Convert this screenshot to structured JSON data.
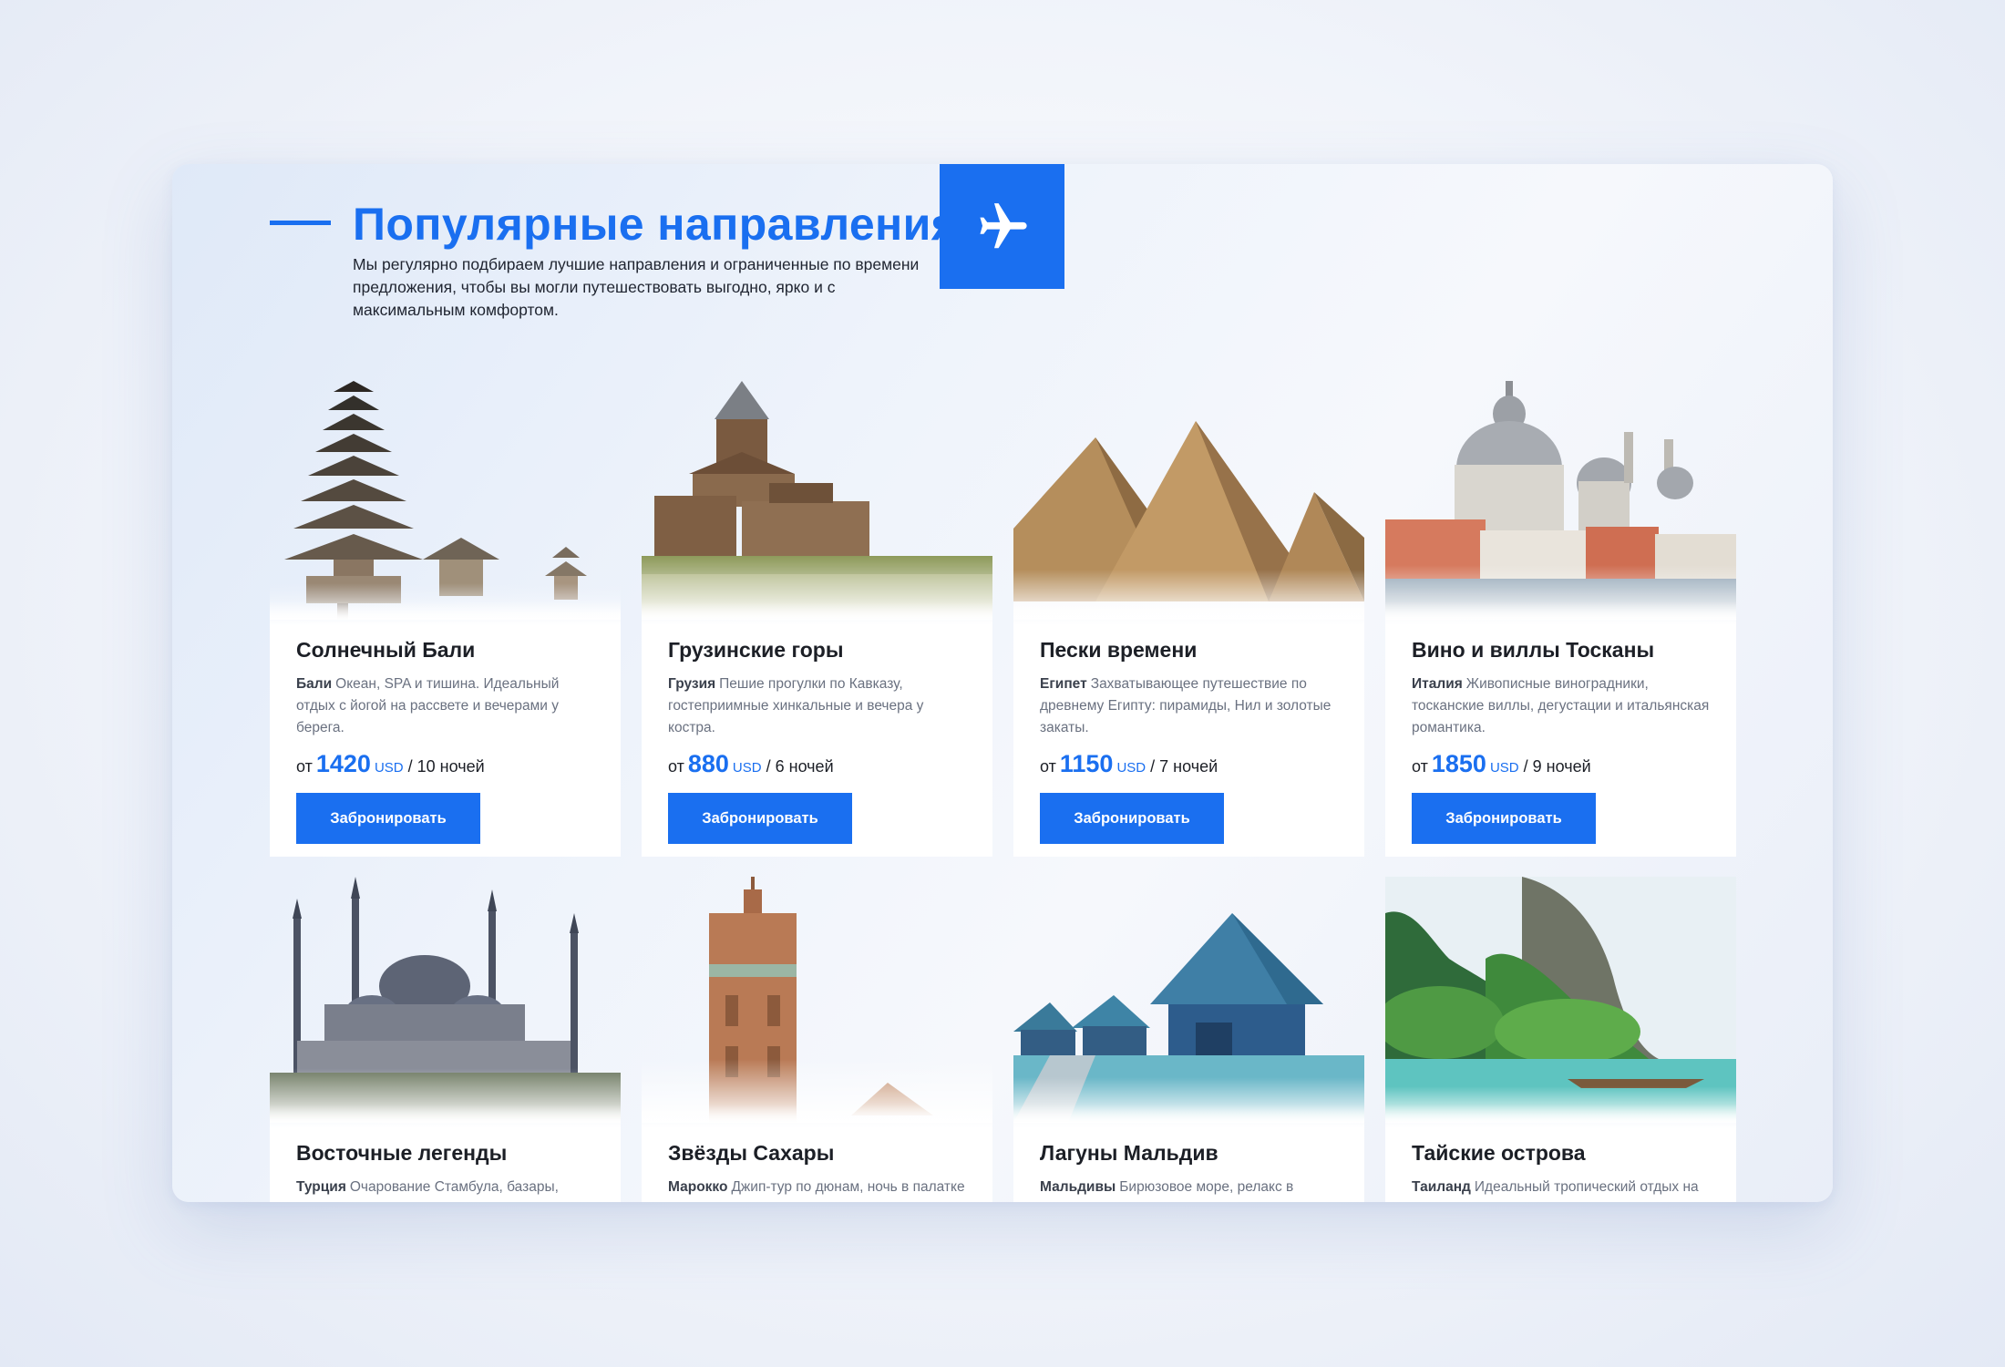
{
  "section": {
    "title": "Популярные направления",
    "description": "Мы регулярно подбираем лучшие направления и ограниченные по времени предложения, чтобы вы могли путешествовать выгодно, ярко и с максимальным комфортом.",
    "icon": "airplane-icon"
  },
  "colors": {
    "accent": "#1a6ff0",
    "text": "#1c1f26",
    "muted": "#6a7180"
  },
  "cards": [
    {
      "title": "Солнечный Бали",
      "country": "Бали",
      "text": "Океан, SPA и тишина. Идеальный отдых с йогой на рассвете и вечерами у берега.",
      "from": "от",
      "price": "1420",
      "currency": "USD",
      "nights": "/ 10 ночей",
      "button": "Забронировать",
      "image": "bali-temple-image"
    },
    {
      "title": "Грузинские горы",
      "country": "Грузия",
      "text": "Пешие прогулки по Кавказу, гостеприимные хинкальные и вечера у костра.",
      "from": "от",
      "price": "880",
      "currency": "USD",
      "nights": "/ 6 ночей",
      "button": "Забронировать",
      "image": "georgia-church-image"
    },
    {
      "title": "Пески времени",
      "country": "Египет",
      "text": "Захватывающее путешествие по древнему Египту: пирамиды, Нил и золотые закаты.",
      "from": "от",
      "price": "1150",
      "currency": "USD",
      "nights": "/ 7 ночей",
      "button": "Забронировать",
      "image": "egypt-pyramids-image"
    },
    {
      "title": "Вино и виллы Тосканы",
      "country": "Италия",
      "text": "Живописные виноградники, тосканские виллы, дегустации и итальянская романтика.",
      "from": "от",
      "price": "1850",
      "currency": "USD",
      "nights": "/ 9 ночей",
      "button": "Забронировать",
      "image": "italy-venice-image"
    },
    {
      "title": "Восточные легенды",
      "country": "Турция",
      "text": "Очарование Стамбула, базары, дворцы и прогулки по Босфору. Восток в",
      "image": "turkey-mosque-image"
    },
    {
      "title": "Звёзды Сахары",
      "country": "Марокко",
      "text": "Джип-тур по дюнам, ночь в палатке под открытым небом и закаты, что",
      "image": "morocco-minaret-image"
    },
    {
      "title": "Лагуны Мальдив",
      "country": "Мальдивы",
      "text": "Бирюзовое море, релакс в бунгало и закаты, которые хочется",
      "image": "maldives-bungalow-image"
    },
    {
      "title": "Тайские острова",
      "country": "Таиланд",
      "text": "Идеальный тропический отдых на Пхукете: пляжи, храмы, тайский массаж и",
      "image": "thailand-island-image"
    }
  ]
}
